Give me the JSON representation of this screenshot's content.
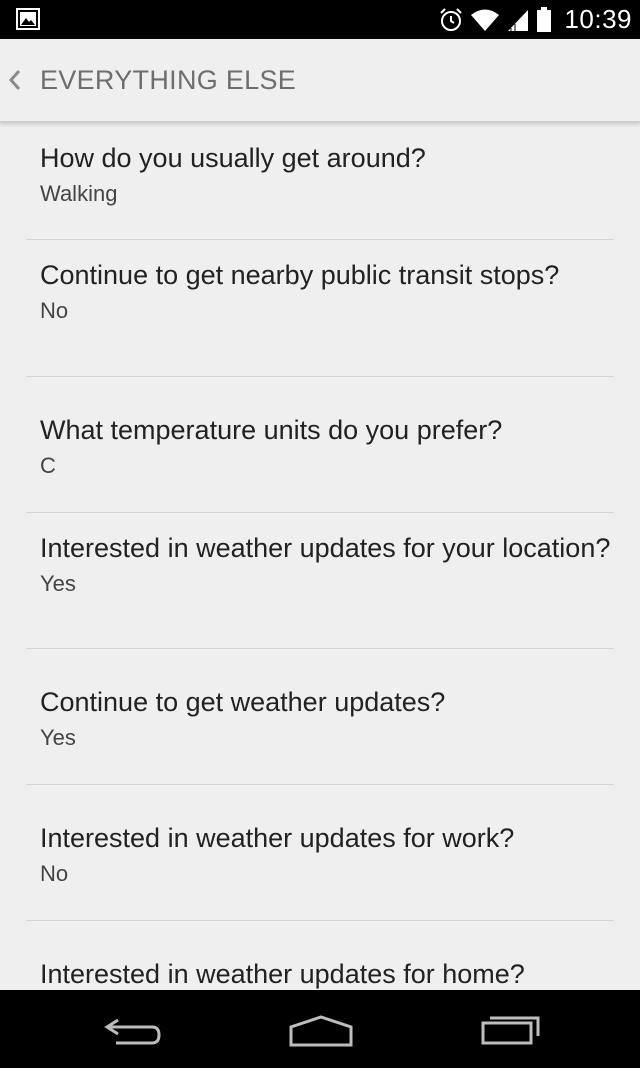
{
  "status_bar": {
    "time": "10:39",
    "icons": [
      "image-icon",
      "alarm-icon",
      "wifi-icon",
      "signal-icon",
      "battery-icon"
    ]
  },
  "action_bar": {
    "title": "EVERYTHING ELSE",
    "back_icon": "chevron-left-icon"
  },
  "settings": [
    {
      "question": "How do you usually get around?",
      "answer": "Walking"
    },
    {
      "question": "Continue to get nearby public transit stops?",
      "answer": "No"
    },
    {
      "question": "What temperature units do you prefer?",
      "answer": "C"
    },
    {
      "question": "Interested in weather updates for your location?",
      "answer": "Yes"
    },
    {
      "question": "Continue to get weather updates?",
      "answer": "Yes"
    },
    {
      "question": "Interested in weather updates for work?",
      "answer": "No"
    },
    {
      "question": "Interested in weather updates for home?",
      "answer": ""
    }
  ],
  "nav_bar": {
    "icons": [
      "back-icon",
      "home-icon",
      "recents-icon"
    ]
  },
  "colors": {
    "background": "#efefef",
    "status_bar": "#000000",
    "title_text": "#6e6e6e",
    "divider": "#d4d4d4"
  }
}
